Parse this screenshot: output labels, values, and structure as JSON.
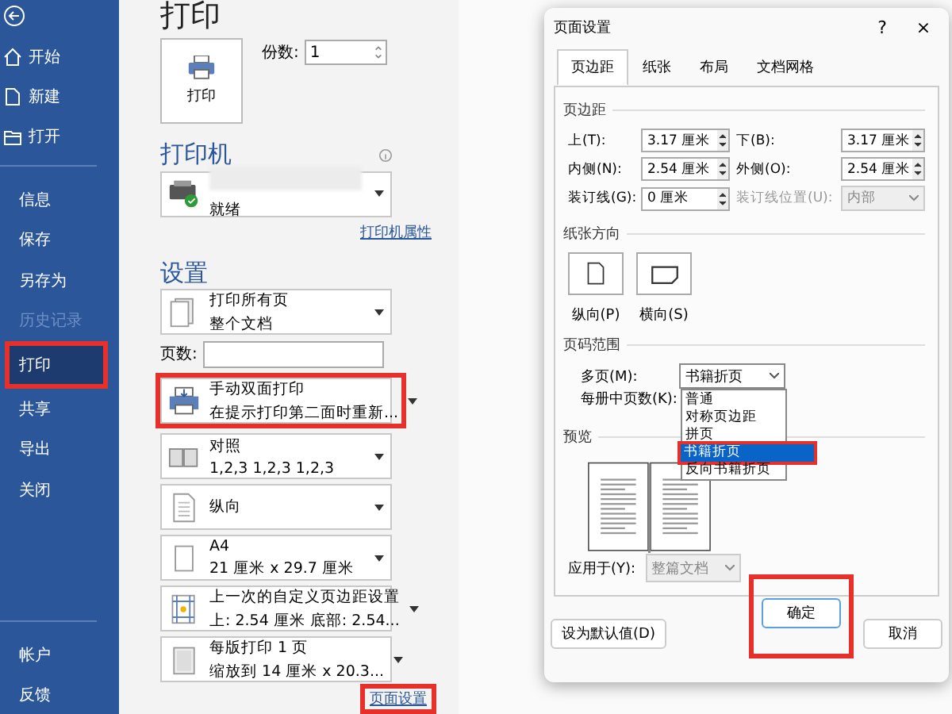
{
  "sidebar": {
    "nav_items": [
      {
        "label": "开始"
      },
      {
        "label": "新建"
      },
      {
        "label": "打开"
      }
    ],
    "items": [
      {
        "label": "信息",
        "selected": false,
        "disabled": false,
        "highlighted": false
      },
      {
        "label": "保存",
        "selected": false,
        "disabled": false,
        "highlighted": false
      },
      {
        "label": "另存为",
        "selected": false,
        "disabled": false,
        "highlighted": false
      },
      {
        "label": "历史记录",
        "selected": false,
        "disabled": true,
        "highlighted": false
      },
      {
        "label": "打印",
        "selected": true,
        "disabled": false,
        "highlighted": true
      },
      {
        "label": "共享",
        "selected": false,
        "disabled": false,
        "highlighted": false
      },
      {
        "label": "导出",
        "selected": false,
        "disabled": false,
        "highlighted": false
      },
      {
        "label": "关闭",
        "selected": false,
        "disabled": false,
        "highlighted": false
      }
    ],
    "footer_items": [
      {
        "label": "帐户"
      },
      {
        "label": "反馈"
      }
    ]
  },
  "print_panel": {
    "title": "打印",
    "print_button": "打印",
    "copies_label": "份数:",
    "copies_value": "1",
    "printer_heading": "打印机",
    "printer_status": "就绪",
    "printer_properties_link": "打印机属性",
    "settings_heading": "设置",
    "settings": [
      {
        "line1": "打印所有页",
        "line2": "整个文档",
        "highlighted": false
      },
      {
        "kind": "pages",
        "label": "页数:"
      },
      {
        "line1": "手动双面打印",
        "line2": "在提示打印第二面时重新...",
        "highlighted": true
      },
      {
        "line1": "对照",
        "line2": "1,2,3    1,2,3    1,2,3",
        "highlighted": false
      },
      {
        "line1": "纵向",
        "highlighted": false
      },
      {
        "line1": "A4",
        "line2": "21 厘米 x 29.7 厘米",
        "highlighted": false
      },
      {
        "line1": "上一次的自定义页边距设置",
        "line2": "上: 2.54 厘米 底部: 2.54...",
        "highlighted": false
      },
      {
        "line1": "每版打印 1 页",
        "line2": "缩放到 14 厘米 x 20.3...",
        "highlighted": false
      }
    ],
    "page_setup_link": "页面设置",
    "page_setup_highlighted": true
  },
  "dialog": {
    "title": "页面设置",
    "help": "?",
    "close": "×",
    "tabs": [
      {
        "label": "页边距",
        "selected": true
      },
      {
        "label": "纸张",
        "selected": false
      },
      {
        "label": "布局",
        "selected": false
      },
      {
        "label": "文档网格",
        "selected": false
      }
    ],
    "margins_heading": "页边距",
    "margin_fields": [
      {
        "label": "上(T):",
        "value": "3.17 厘米"
      },
      {
        "label": "下(B):",
        "value": "3.17 厘米"
      },
      {
        "label": "内侧(N):",
        "value": "2.54 厘米"
      },
      {
        "label": "外侧(O):",
        "value": "2.54 厘米"
      },
      {
        "label": "装订线(G):",
        "value": "0 厘米"
      }
    ],
    "gutter_position": {
      "label": "装订线位置(U):",
      "value": "内部",
      "disabled": true
    },
    "orientation_heading": "纸张方向",
    "orientation_options": [
      {
        "label": "纵向(P)"
      },
      {
        "label": "横向(S)"
      }
    ],
    "pages_heading": "页码范围",
    "multiple_pages_label": "多页(M):",
    "multiple_pages_value": "书籍折页",
    "sheets_label": "每册中页数(K):",
    "multiple_pages_options": [
      {
        "label": "普通",
        "selected": false
      },
      {
        "label": "对称页边距",
        "selected": false
      },
      {
        "label": "拼页",
        "selected": false
      },
      {
        "label": "书籍折页",
        "selected": true,
        "highlighted": true
      },
      {
        "label": "反向书籍折页",
        "selected": false
      }
    ],
    "preview_heading": "预览",
    "apply_label": "应用于(Y):",
    "apply_value": "整篇文档",
    "default_button": "设为默认值(D)",
    "ok_button": "确定",
    "ok_highlighted": true,
    "cancel_button": "取消"
  }
}
